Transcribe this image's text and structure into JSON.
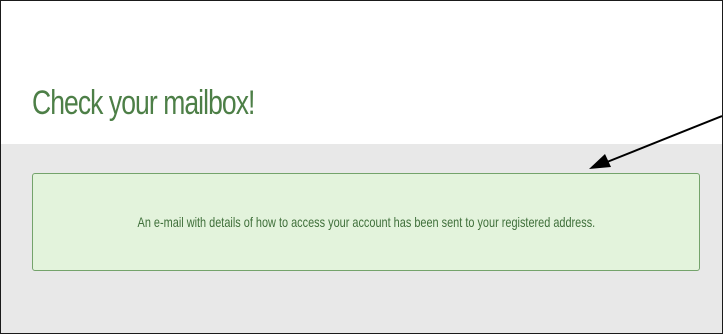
{
  "page": {
    "title": "Check your mailbox!",
    "notice_text": "An e-mail with details of how to access your account has been sent to your registered address."
  },
  "annotation": {
    "icon": "arrow-icon"
  },
  "colors": {
    "title": "#4d7f47",
    "notice_background": "#e3f3dc",
    "notice_border": "#74a36b",
    "notice_text": "#3f6f3a",
    "band_background": "#e8e8e8"
  }
}
